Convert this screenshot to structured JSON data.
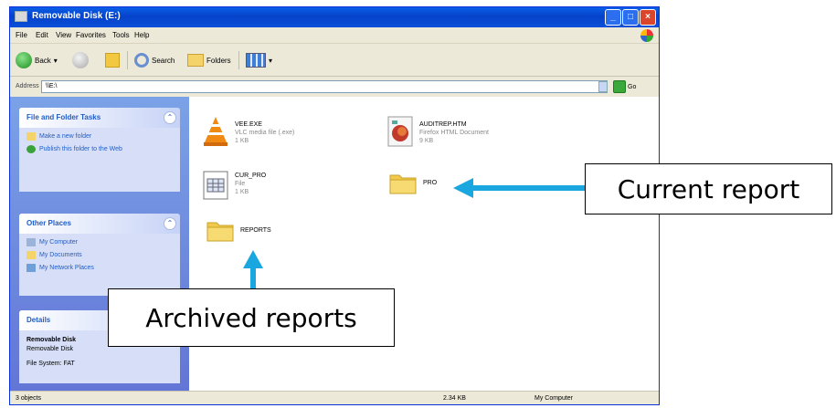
{
  "window": {
    "title": "Removable Disk (E:)",
    "controls": [
      "_",
      "□",
      "×"
    ]
  },
  "menu": [
    "File",
    "Edit",
    "View",
    "Favorites",
    "Tools",
    "Help"
  ],
  "toolbar": {
    "back_label": "Back",
    "search_label": "Search",
    "folders_label": "Folders"
  },
  "address": {
    "label": "Address",
    "value": "\\\\E:\\",
    "go_label": "Go"
  },
  "taskpane": {
    "file_tasks": {
      "title": "File and Folder Tasks",
      "links": [
        "Make a new folder",
        "Publish this folder to the Web"
      ]
    },
    "other_places": {
      "title": "Other Places",
      "links": [
        "My Computer",
        "My Documents",
        "My Network Places"
      ]
    },
    "details": {
      "title": "Details",
      "name": "Removable Disk",
      "type": "Removable Disk",
      "filesystem": "File System: FAT"
    }
  },
  "files": [
    {
      "name": "VEE.EXE",
      "line2": "VLC media file (.exe)",
      "line3": "1 KB",
      "icon": "vlc-cone-icon"
    },
    {
      "name": "AUDITREP.HTM",
      "line2": "Firefox HTML Document",
      "line3": "9 KB",
      "icon": "html-document-icon"
    },
    {
      "name": "CUR_PRO",
      "line2": "File",
      "line3": "1 KB",
      "icon": "text-file-icon"
    },
    {
      "name": "PRO",
      "line2": "",
      "line3": "",
      "icon": "folder-icon"
    },
    {
      "name": "REPORTS",
      "line2": "",
      "line3": "",
      "icon": "folder-icon"
    }
  ],
  "status": {
    "objects": "3 objects",
    "size": "2.34 KB",
    "location": "My Computer"
  },
  "callouts": {
    "current": "Current report",
    "archived": "Archived reports"
  },
  "colors": {
    "titlebar": "#0a5fe8",
    "taskpane": "#7ba2e7",
    "arrow": "#1aa7e0"
  }
}
